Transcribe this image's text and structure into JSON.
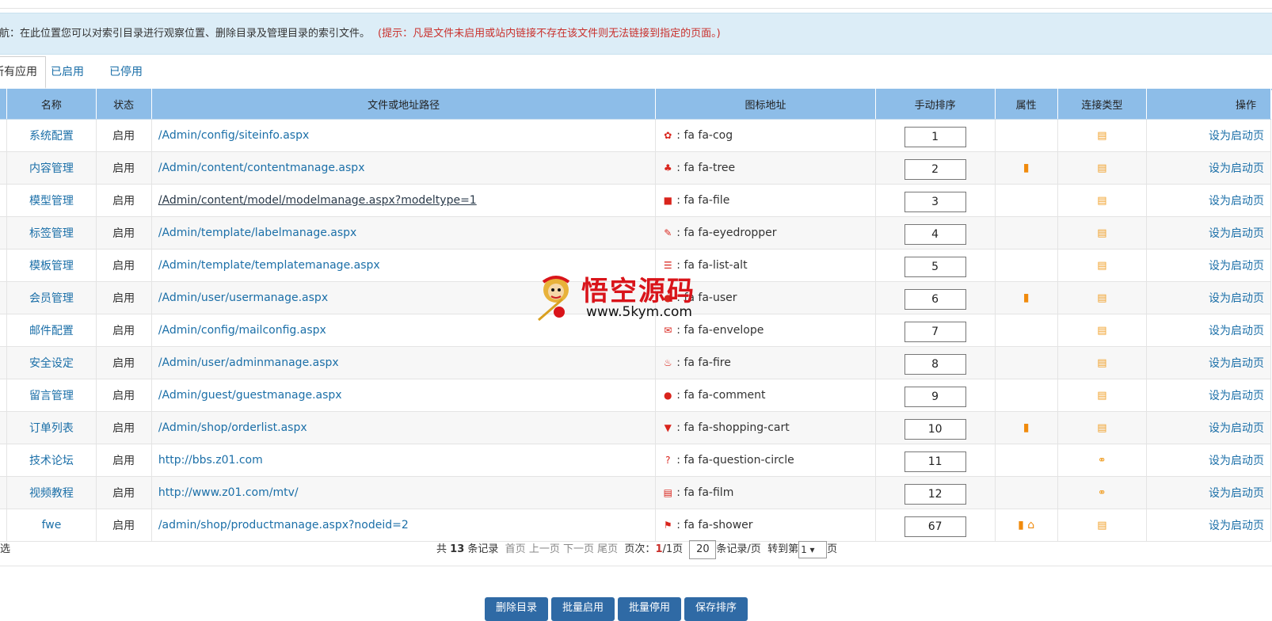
{
  "notice": {
    "text": "导航：在此位置您可以对索引目录进行观察位置、删除目录及管理目录的索引文件。",
    "hint": "(提示：凡是文件未启用或站内链接不存在该文件则无法链接到指定的页面。)"
  },
  "tabs": [
    "所有应用",
    "已启用",
    "已停用"
  ],
  "columns": [
    "名称",
    "状态",
    "文件或地址路径",
    "图标地址",
    "手动排序",
    "属性",
    "连接类型",
    "操作"
  ],
  "rows": [
    {
      "name": "系统配置",
      "status": "启用",
      "path": "/Admin/config/siteinfo.aspx",
      "icon": "fa fa-cog",
      "icon_glyph": "✿",
      "sort": "1",
      "attr": [],
      "link": "page",
      "op": "设为启动页"
    },
    {
      "name": "内容管理",
      "status": "启用",
      "path": "/Admin/content/contentmanage.aspx",
      "icon": "fa fa-tree",
      "icon_glyph": "♣",
      "sort": "2",
      "attr": [
        "mobile"
      ],
      "link": "page",
      "op": "设为启动页"
    },
    {
      "name": "模型管理",
      "status": "启用",
      "path": "/Admin/content/model/modelmanage.aspx?modeltype=1",
      "icon": "fa fa-file",
      "icon_glyph": "■",
      "sort": "3",
      "attr": [],
      "link": "page",
      "op": "设为启动页"
    },
    {
      "name": "标签管理",
      "status": "启用",
      "path": "/Admin/template/labelmanage.aspx",
      "icon": "fa fa-eyedropper",
      "icon_glyph": "✎",
      "sort": "4",
      "attr": [],
      "link": "page",
      "op": "设为启动页"
    },
    {
      "name": "模板管理",
      "status": "启用",
      "path": "/Admin/template/templatemanage.aspx",
      "icon": "fa fa-list-alt",
      "icon_glyph": "☰",
      "sort": "5",
      "attr": [],
      "link": "page",
      "op": "设为启动页"
    },
    {
      "name": "会员管理",
      "status": "启用",
      "path": "/Admin/user/usermanage.aspx",
      "icon": "fa fa-user",
      "icon_glyph": "●",
      "sort": "6",
      "attr": [
        "mobile"
      ],
      "link": "page",
      "op": "设为启动页"
    },
    {
      "name": "邮件配置",
      "status": "启用",
      "path": "/Admin/config/mailconfig.aspx",
      "icon": "fa fa-envelope",
      "icon_glyph": "✉",
      "sort": "7",
      "attr": [],
      "link": "page",
      "op": "设为启动页"
    },
    {
      "name": "安全设定",
      "status": "启用",
      "path": "/Admin/user/adminmanage.aspx",
      "icon": "fa fa-fire",
      "icon_glyph": "♨",
      "sort": "8",
      "attr": [],
      "link": "page",
      "op": "设为启动页"
    },
    {
      "name": "留言管理",
      "status": "启用",
      "path": "/Admin/guest/guestmanage.aspx",
      "icon": "fa fa-comment",
      "icon_glyph": "●",
      "sort": "9",
      "attr": [],
      "link": "page",
      "op": "设为启动页"
    },
    {
      "name": "订单列表",
      "status": "启用",
      "path": "/Admin/shop/orderlist.aspx",
      "icon": "fa fa-shopping-cart",
      "icon_glyph": "▼",
      "sort": "10",
      "attr": [
        "mobile"
      ],
      "link": "page",
      "op": "设为启动页"
    },
    {
      "name": "技术论坛",
      "status": "启用",
      "path": "http://bbs.z01.com",
      "icon": "fa fa-question-circle",
      "icon_glyph": "?",
      "sort": "11",
      "attr": [],
      "link": "url",
      "op": "设为启动页"
    },
    {
      "name": "视频教程",
      "status": "启用",
      "path": "http://www.z01.com/mtv/",
      "icon": "fa fa-film",
      "icon_glyph": "▤",
      "sort": "12",
      "attr": [],
      "link": "url",
      "op": "设为启动页"
    },
    {
      "name": "fwe",
      "status": "启用",
      "path": "/admin/shop/productmanage.aspx?nodeid=2",
      "icon": "fa fa-shower",
      "icon_glyph": "⚑",
      "sort": "67",
      "attr": [
        "mobile",
        "home"
      ],
      "link": "page",
      "op": "设为启动页"
    }
  ],
  "pager": {
    "select_label": "选",
    "total_prefix": "共",
    "total": "13",
    "total_suffix": "条记录",
    "first": "首页",
    "prev": "上一页",
    "next": "下一页",
    "last": "尾页",
    "page_label": "页次：",
    "current": "1",
    "pages": "/1页",
    "per_page": "20",
    "per_page_suffix": "条记录/页",
    "goto_label": "转到第",
    "goto_value": "1",
    "goto_suffix": "页"
  },
  "buttons": [
    "删除目录",
    "批量启用",
    "批量停用",
    "保存排序"
  ],
  "watermark": {
    "title": "悟空源码",
    "url": "www.5kym.com"
  },
  "colors": {
    "header_bg": "#8dbde8",
    "link": "#1b6fa8",
    "icon_red": "#d9241c",
    "icon_orange": "#f08a0c",
    "notice_bg": "#dcedf7",
    "button": "#2f6aa5"
  }
}
